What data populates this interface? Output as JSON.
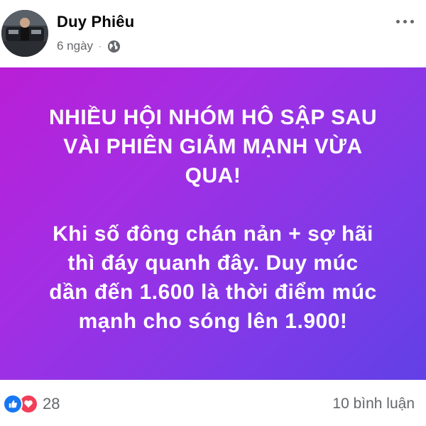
{
  "post": {
    "author": "Duy Phiêu",
    "time": "6 ngày",
    "separator": "·",
    "privacy_icon": "globe-icon",
    "more_icon": "more-options-icon"
  },
  "card": {
    "background_colors": [
      "#b91fd6",
      "#6140e6"
    ],
    "lines_1": [
      "NHIỀU HỘI NHÓM HÔ SẬP SAU",
      "VÀI PHIÊN GIẢM MẠNH VỪA",
      "QUA!"
    ],
    "lines_2": [
      "Khi số đông chán nản + sợ hãi",
      "thì đáy quanh đây. Duy múc",
      "dần đến 1.600 là thời điểm múc",
      "mạnh cho sóng lên 1.900!"
    ]
  },
  "footer": {
    "reaction_icons": [
      "like-icon",
      "love-icon"
    ],
    "reaction_count": "28",
    "comments": "10 bình luận"
  }
}
